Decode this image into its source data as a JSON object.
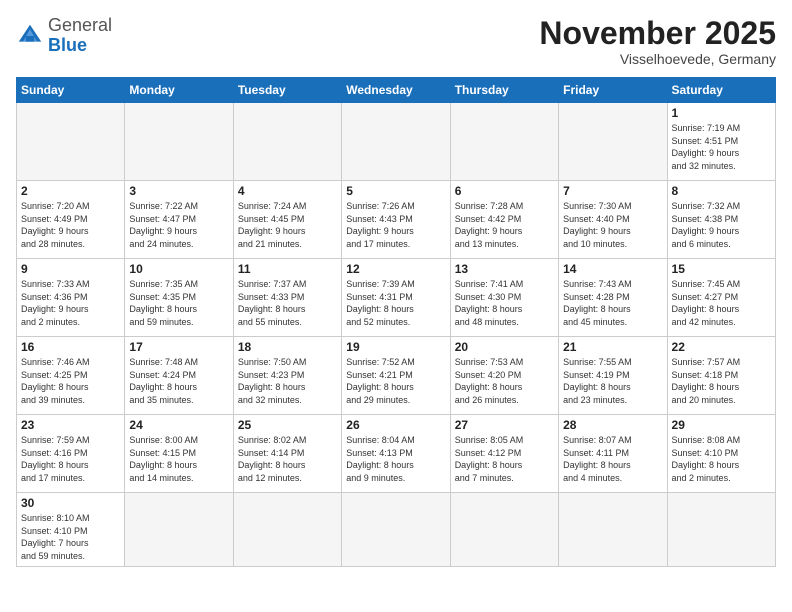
{
  "logo": {
    "general": "General",
    "blue": "Blue"
  },
  "header": {
    "month": "November 2025",
    "location": "Visselhoevede, Germany"
  },
  "weekdays": [
    "Sunday",
    "Monday",
    "Tuesday",
    "Wednesday",
    "Thursday",
    "Friday",
    "Saturday"
  ],
  "weeks": [
    [
      {
        "day": "",
        "info": ""
      },
      {
        "day": "",
        "info": ""
      },
      {
        "day": "",
        "info": ""
      },
      {
        "day": "",
        "info": ""
      },
      {
        "day": "",
        "info": ""
      },
      {
        "day": "",
        "info": ""
      },
      {
        "day": "1",
        "info": "Sunrise: 7:19 AM\nSunset: 4:51 PM\nDaylight: 9 hours\nand 32 minutes."
      }
    ],
    [
      {
        "day": "2",
        "info": "Sunrise: 7:20 AM\nSunset: 4:49 PM\nDaylight: 9 hours\nand 28 minutes."
      },
      {
        "day": "3",
        "info": "Sunrise: 7:22 AM\nSunset: 4:47 PM\nDaylight: 9 hours\nand 24 minutes."
      },
      {
        "day": "4",
        "info": "Sunrise: 7:24 AM\nSunset: 4:45 PM\nDaylight: 9 hours\nand 21 minutes."
      },
      {
        "day": "5",
        "info": "Sunrise: 7:26 AM\nSunset: 4:43 PM\nDaylight: 9 hours\nand 17 minutes."
      },
      {
        "day": "6",
        "info": "Sunrise: 7:28 AM\nSunset: 4:42 PM\nDaylight: 9 hours\nand 13 minutes."
      },
      {
        "day": "7",
        "info": "Sunrise: 7:30 AM\nSunset: 4:40 PM\nDaylight: 9 hours\nand 10 minutes."
      },
      {
        "day": "8",
        "info": "Sunrise: 7:32 AM\nSunset: 4:38 PM\nDaylight: 9 hours\nand 6 minutes."
      }
    ],
    [
      {
        "day": "9",
        "info": "Sunrise: 7:33 AM\nSunset: 4:36 PM\nDaylight: 9 hours\nand 2 minutes."
      },
      {
        "day": "10",
        "info": "Sunrise: 7:35 AM\nSunset: 4:35 PM\nDaylight: 8 hours\nand 59 minutes."
      },
      {
        "day": "11",
        "info": "Sunrise: 7:37 AM\nSunset: 4:33 PM\nDaylight: 8 hours\nand 55 minutes."
      },
      {
        "day": "12",
        "info": "Sunrise: 7:39 AM\nSunset: 4:31 PM\nDaylight: 8 hours\nand 52 minutes."
      },
      {
        "day": "13",
        "info": "Sunrise: 7:41 AM\nSunset: 4:30 PM\nDaylight: 8 hours\nand 48 minutes."
      },
      {
        "day": "14",
        "info": "Sunrise: 7:43 AM\nSunset: 4:28 PM\nDaylight: 8 hours\nand 45 minutes."
      },
      {
        "day": "15",
        "info": "Sunrise: 7:45 AM\nSunset: 4:27 PM\nDaylight: 8 hours\nand 42 minutes."
      }
    ],
    [
      {
        "day": "16",
        "info": "Sunrise: 7:46 AM\nSunset: 4:25 PM\nDaylight: 8 hours\nand 39 minutes."
      },
      {
        "day": "17",
        "info": "Sunrise: 7:48 AM\nSunset: 4:24 PM\nDaylight: 8 hours\nand 35 minutes."
      },
      {
        "day": "18",
        "info": "Sunrise: 7:50 AM\nSunset: 4:23 PM\nDaylight: 8 hours\nand 32 minutes."
      },
      {
        "day": "19",
        "info": "Sunrise: 7:52 AM\nSunset: 4:21 PM\nDaylight: 8 hours\nand 29 minutes."
      },
      {
        "day": "20",
        "info": "Sunrise: 7:53 AM\nSunset: 4:20 PM\nDaylight: 8 hours\nand 26 minutes."
      },
      {
        "day": "21",
        "info": "Sunrise: 7:55 AM\nSunset: 4:19 PM\nDaylight: 8 hours\nand 23 minutes."
      },
      {
        "day": "22",
        "info": "Sunrise: 7:57 AM\nSunset: 4:18 PM\nDaylight: 8 hours\nand 20 minutes."
      }
    ],
    [
      {
        "day": "23",
        "info": "Sunrise: 7:59 AM\nSunset: 4:16 PM\nDaylight: 8 hours\nand 17 minutes."
      },
      {
        "day": "24",
        "info": "Sunrise: 8:00 AM\nSunset: 4:15 PM\nDaylight: 8 hours\nand 14 minutes."
      },
      {
        "day": "25",
        "info": "Sunrise: 8:02 AM\nSunset: 4:14 PM\nDaylight: 8 hours\nand 12 minutes."
      },
      {
        "day": "26",
        "info": "Sunrise: 8:04 AM\nSunset: 4:13 PM\nDaylight: 8 hours\nand 9 minutes."
      },
      {
        "day": "27",
        "info": "Sunrise: 8:05 AM\nSunset: 4:12 PM\nDaylight: 8 hours\nand 7 minutes."
      },
      {
        "day": "28",
        "info": "Sunrise: 8:07 AM\nSunset: 4:11 PM\nDaylight: 8 hours\nand 4 minutes."
      },
      {
        "day": "29",
        "info": "Sunrise: 8:08 AM\nSunset: 4:10 PM\nDaylight: 8 hours\nand 2 minutes."
      }
    ],
    [
      {
        "day": "30",
        "info": "Sunrise: 8:10 AM\nSunset: 4:10 PM\nDaylight: 7 hours\nand 59 minutes."
      },
      {
        "day": "",
        "info": ""
      },
      {
        "day": "",
        "info": ""
      },
      {
        "day": "",
        "info": ""
      },
      {
        "day": "",
        "info": ""
      },
      {
        "day": "",
        "info": ""
      },
      {
        "day": "",
        "info": ""
      }
    ]
  ]
}
